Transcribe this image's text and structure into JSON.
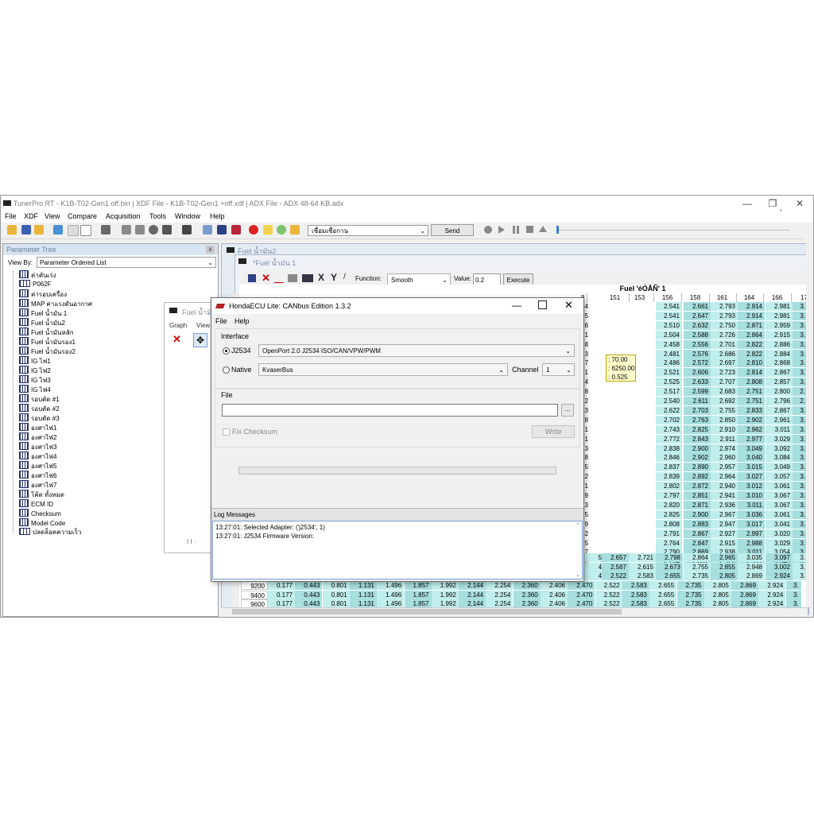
{
  "window": {
    "title": "TunerPro RT - K1B-T02-Gen1 off.bin | XDF File - K1B-T02-Gen1 +off.xdf | ADX File - ADX 48-64 KB.adx",
    "minimize": "—",
    "restore": "❐",
    "close": "✕",
    "restore_glyph": "I"
  },
  "menu": [
    "File",
    "XDF",
    "View",
    "Compare",
    "Acquisition",
    "Tools",
    "Window",
    "Help"
  ],
  "toolbar": {
    "connection_value": "เชื่อมเชื่อกาน",
    "send_label": "Send"
  },
  "parameter_tree": {
    "header": "Parameter Tree",
    "close": "x",
    "view_by_label": "View By:",
    "view_by_value": "Parameter Ordered List",
    "items": [
      "ค่าคันเร่ง",
      "P062F",
      "ค่ารอบเครื่อง",
      "MAP ค่าแรงดันอากาศ",
      "Fuel น้ำมัน 1",
      "Fuel น้ำมัน2",
      "Fuel น้ำมันหลัก",
      "Fuel น้ำมันรอง1",
      "Fuel น้ำมันรอง2",
      "IG ไฟ1",
      "IG ไฟ2",
      "IG ไฟ3",
      "IG ไฟ4",
      "รอบตัด #1",
      "รอบตัด #2",
      "รอบตัด #3",
      "องศาไฟ1",
      "องศาไฟ2",
      "องศาไฟ3",
      "องศาไฟ4",
      "องศาไฟ5",
      "องศาไฟ6",
      "องศาไฟ7",
      "โค้ด ทั้งหมด",
      "ECM ID",
      "Checksum",
      "Model Code",
      "ปลดล็อคความเร็ว"
    ]
  },
  "fuel2_window": {
    "title": "Fuel น้ำมัน2"
  },
  "fuel1_window": {
    "title": "*Fuel น้ำมัน 1",
    "function_label": "Function:",
    "function_value": "Smooth",
    "value_label": "Value:",
    "value_value": "0.2",
    "execute_label": "Execute",
    "table_title": "Fuel 'éÓÅÑ' 1",
    "column_headers": [
      "8",
      "151",
      "153",
      "156",
      "158",
      "161",
      "164",
      "166",
      "17"
    ],
    "right_rows": [
      [
        "4",
        "2.541",
        "2.661",
        "2.793",
        "2.914",
        "2.981",
        "3."
      ],
      [
        "5",
        "2.541",
        "2.647",
        "2.793",
        "2.914",
        "2.981",
        "3."
      ],
      [
        "6",
        "2.510",
        "2.632",
        "2.750",
        "2.871",
        "2.959",
        "3."
      ],
      [
        "1",
        "2.504",
        "2.588",
        "2.726",
        "2.864",
        "2.915",
        "3."
      ],
      [
        "8",
        "2.458",
        "2.556",
        "2.701",
        "2.822",
        "2.886",
        "3."
      ],
      [
        "3",
        "2.481",
        "2.576",
        "2.686",
        "2.822",
        "2.884",
        "3."
      ],
      [
        "7",
        "2.486",
        "2.572",
        "2.697",
        "2.810",
        "2.868",
        "3."
      ],
      [
        "1",
        "2.521",
        "2.606",
        "2.723",
        "2.814",
        "2.867",
        "3."
      ],
      [
        "4",
        "2.525",
        "2.633",
        "2.707",
        "2.808",
        "2.857",
        "3."
      ],
      [
        "8",
        "2.517",
        "2.599",
        "2.683",
        "2.751",
        "2.800",
        "2."
      ],
      [
        "2",
        "2.540",
        "2.611",
        "2.692",
        "2.751",
        "2.796",
        "2."
      ],
      [
        "3",
        "2.622",
        "2.703",
        "2.755",
        "2.833",
        "2.867",
        "3."
      ],
      [
        "8",
        "2.702",
        "2.763",
        "2.850",
        "2.902",
        "2.961",
        "3."
      ],
      [
        "1",
        "2.743",
        "2.825",
        "2.910",
        "2.962",
        "3.011",
        "3."
      ],
      [
        "1",
        "2.772",
        "2.843",
        "2.911",
        "2.977",
        "3.029",
        "3."
      ],
      [
        "3",
        "2.838",
        "2.900",
        "2.974",
        "3.049",
        "3.092",
        "3."
      ],
      [
        "8",
        "2.846",
        "2.902",
        "2.960",
        "3.040",
        "3.084",
        "3."
      ],
      [
        "5",
        "2.837",
        "2.890",
        "2.957",
        "3.015",
        "3.049",
        "3."
      ],
      [
        "2",
        "2.839",
        "2.892",
        "2.964",
        "3.027",
        "3.057",
        "3."
      ],
      [
        "1",
        "2.802",
        "2.872",
        "2.940",
        "3.012",
        "3.061",
        "3."
      ],
      [
        "9",
        "2.797",
        "2.851",
        "2.941",
        "3.010",
        "3.067",
        "3."
      ],
      [
        "3",
        "2.820",
        "2.871",
        "2.936",
        "3.011",
        "3.067",
        "3."
      ],
      [
        "5",
        "2.825",
        "2.900",
        "2.967",
        "3.036",
        "3.061",
        "3."
      ],
      [
        "9",
        "2.808",
        "2.883",
        "2.947",
        "3.017",
        "3.041",
        "3."
      ],
      [
        "2",
        "2.791",
        "2.867",
        "2.927",
        "2.997",
        "3.020",
        "3."
      ],
      [
        "5",
        "2.764",
        "2.847",
        "2.915",
        "2.988",
        "3.029",
        "3."
      ],
      [
        "7",
        "2.790",
        "2.869",
        "2.938",
        "3.011",
        "3.054",
        "3."
      ],
      [
        "0",
        "2.764",
        "2.837",
        "2.920",
        "2.991",
        "3.043",
        "3."
      ]
    ],
    "lower_rows": [
      [
        "573",
        "2.657",
        "2.721",
        "2.798",
        "2.864",
        "2.965",
        "3.035",
        "3.097",
        "3."
      ],
      [
        "486",
        "2.567",
        "2.615",
        "2.673",
        "2.755",
        "2.855",
        "2.948",
        "3.002",
        "3."
      ],
      [
        "470",
        "2.522",
        "2.583",
        "2.655",
        "2.735",
        "2.805",
        "2.869",
        "2.924",
        "3."
      ]
    ],
    "bottom_rows": [
      [
        "9200",
        "0.177",
        "0.443",
        "0.801",
        "1.131",
        "1.496",
        "1.857",
        "1.992",
        "2.144",
        "2.254",
        "2.360",
        "2.406",
        "2.470",
        "2.522",
        "2.583",
        "2.655",
        "2.735",
        "2.805",
        "2.869",
        "2.924",
        "3."
      ],
      [
        "9400",
        "0.177",
        "0.443",
        "0.801",
        "1.131",
        "1.496",
        "1.857",
        "1.992",
        "2.144",
        "2.254",
        "2.360",
        "2.406",
        "2.470",
        "2.522",
        "2.583",
        "2.655",
        "2.735",
        "2.805",
        "2.869",
        "2.924",
        "3."
      ],
      [
        "9600",
        "0.177",
        "0.443",
        "0.801",
        "1.131",
        "1.496",
        "1.857",
        "1.992",
        "2.144",
        "2.254",
        "2.360",
        "2.406",
        "2.470",
        "2.522",
        "2.583",
        "2.655",
        "2.735",
        "2.805",
        "2.869",
        "2.924",
        "3."
      ]
    ],
    "tooltip": [
      ": 70.00",
      ": 6250.00",
      ": 0.525"
    ]
  },
  "graph_window": {
    "title": "Fuel น้ำมัน",
    "tabs": [
      "Graph",
      "View"
    ],
    "footer": "I I ·"
  },
  "dialog": {
    "title": "HondaECU Lite: CANbus Edition 1.3.2",
    "menu": [
      "File",
      "Help"
    ],
    "interface_label": "Interface",
    "j2534_label": "J2534",
    "j2534_value": "OpenPort 2.0 J2534 ISO/CAN/VPW/PWM",
    "native_label": "Native",
    "native_value": "KvaserBus",
    "channel_label": "Channel",
    "channel_value": "1",
    "file_label": "File",
    "browse_label": "...",
    "fix_checksum_label": "Fix Checksum",
    "write_label": "Write",
    "log_header": "Log Messages",
    "log_lines": [
      "13:27:01: Selected Adapter: ('j2534', 1)",
      "13:27:01: J2534 Firmware Version:"
    ]
  },
  "colors": {
    "cell_cyan": "#c0eeec",
    "cell_teal": "#a7dede",
    "tree_header": "#d7e4f2",
    "tooltip_bg": "#ffffcc"
  }
}
